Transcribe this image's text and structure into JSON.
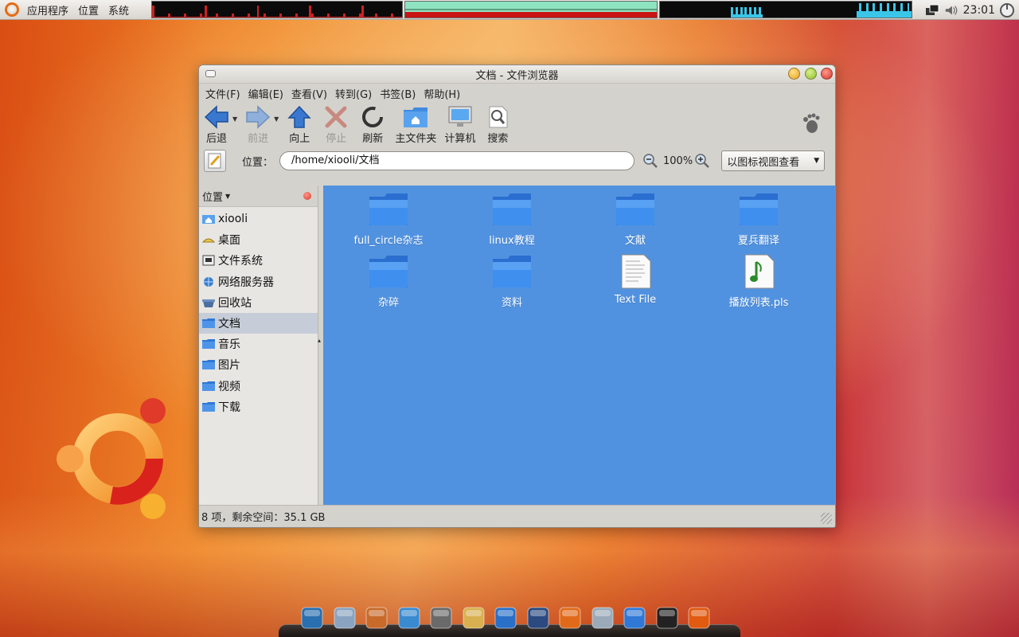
{
  "panel": {
    "menus": [
      "应用程序",
      "位置",
      "系统"
    ],
    "clock": "23:01"
  },
  "window": {
    "title": "文档 - 文件浏览器",
    "menubar": [
      "文件(F)",
      "编辑(E)",
      "查看(V)",
      "转到(G)",
      "书签(B)",
      "帮助(H)"
    ],
    "toolbar": {
      "back": "后退",
      "forward": "前进",
      "up": "向上",
      "stop": "停止",
      "reload": "刷新",
      "home": "主文件夹",
      "computer": "计算机",
      "search": "搜索"
    },
    "location": {
      "label": "位置：",
      "path": "/home/xiooli/文档",
      "zoom": "100%",
      "view_mode": "以图标视图查看"
    },
    "sidebar": {
      "header": "位置",
      "items": [
        "xiooli",
        "桌面",
        "文件系统",
        "网络服务器",
        "回收站",
        "文档",
        "音乐",
        "图片",
        "视频",
        "下载"
      ],
      "active_index": 5
    },
    "files": [
      {
        "name": "full_circle杂志",
        "type": "folder"
      },
      {
        "name": "linux教程",
        "type": "folder"
      },
      {
        "name": "文献",
        "type": "folder"
      },
      {
        "name": "夏兵翻译",
        "type": "folder"
      },
      {
        "name": "杂碎",
        "type": "folder"
      },
      {
        "name": "资料",
        "type": "folder"
      },
      {
        "name": "Text File",
        "type": "text-file"
      },
      {
        "name": "播放列表.pls",
        "type": "audio-playlist"
      }
    ],
    "status": "8 项，剩余空间：35.1 GB"
  },
  "dock": [
    "system-monitor-icon",
    "network-icon",
    "gimp-icon",
    "messenger-icon",
    "media-player-icon",
    "disc-icon",
    "globe-icon",
    "terminal-screen-icon",
    "firefox-icon",
    "file-manager-icon",
    "folder-icon",
    "terminal-icon",
    "ubuntu-icon"
  ],
  "colors": {
    "icon_view_bg": "#5192e0",
    "ubuntu_orange": "#e56c17"
  }
}
